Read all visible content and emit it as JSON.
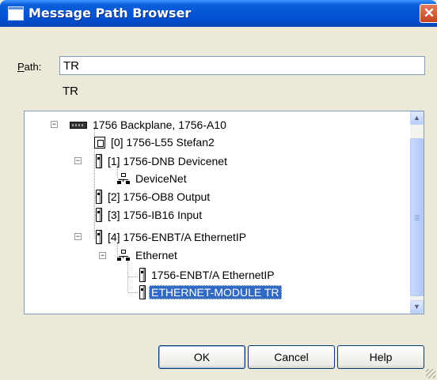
{
  "window": {
    "title": "Message Path Browser",
    "close_glyph": "✕"
  },
  "path": {
    "label_accel": "P",
    "label_rest": "ath:",
    "value": "TR",
    "display": "TR"
  },
  "tree": {
    "nodes": [
      {
        "label": "1756 Backplane, 1756-A10",
        "icon": "backplane-icon",
        "expanded": true
      },
      {
        "label": "[0] 1756-L55 Stefan2",
        "icon": "cpu-icon"
      },
      {
        "label": "[1] 1756-DNB Devicenet",
        "icon": "module-icon",
        "expanded": true
      },
      {
        "label": "DeviceNet",
        "icon": "network-icon"
      },
      {
        "label": "[2] 1756-OB8 Output",
        "icon": "module-icon"
      },
      {
        "label": "[3] 1756-IB16 Input",
        "icon": "module-icon"
      },
      {
        "label": "[4] 1756-ENBT/A EthernetIP",
        "icon": "module-icon",
        "expanded": true
      },
      {
        "label": "Ethernet",
        "icon": "network-icon",
        "expanded": true
      },
      {
        "label": "1756-ENBT/A EthernetIP",
        "icon": "module-icon"
      },
      {
        "label": "ETHERNET-MODULE TR",
        "icon": "module-icon",
        "selected": true
      }
    ],
    "expander_glyph": "−"
  },
  "scrollbar": {
    "up_glyph": "▲",
    "down_glyph": "▼"
  },
  "buttons": {
    "ok": "OK",
    "cancel": "Cancel",
    "help": "Help"
  }
}
